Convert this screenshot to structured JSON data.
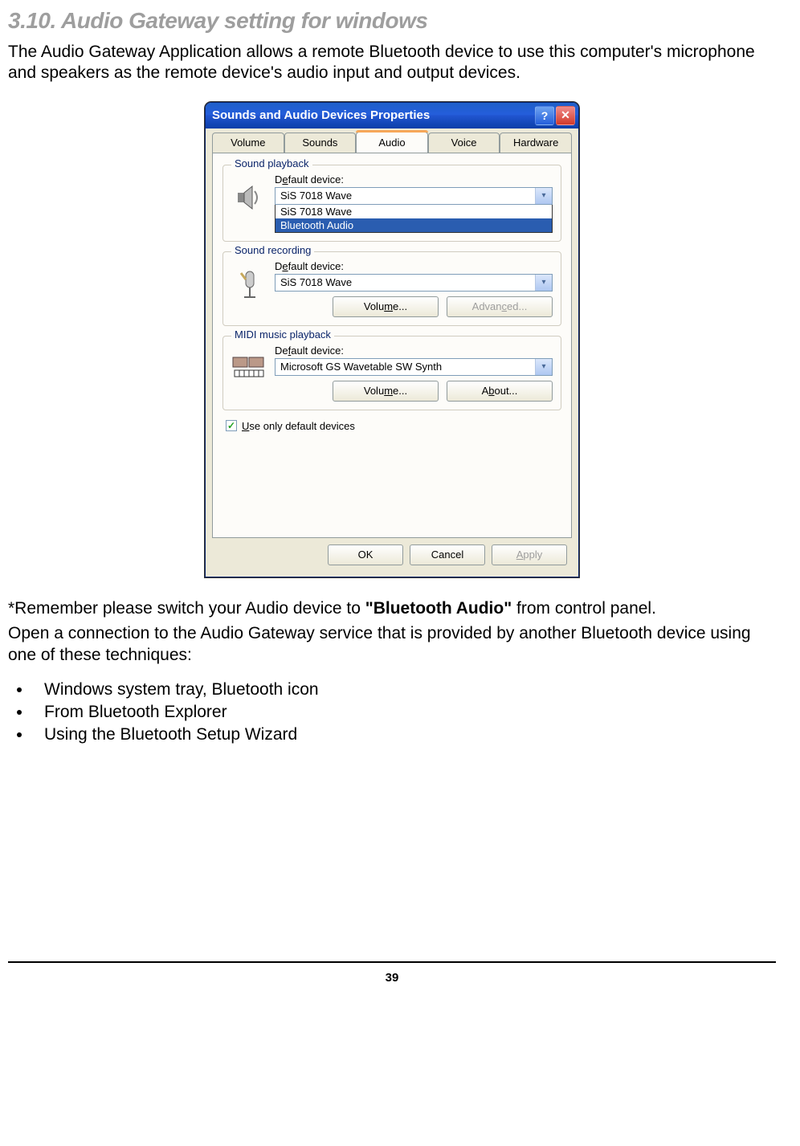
{
  "heading": "3.10. Audio Gateway setting for windows",
  "intro": "The Audio Gateway Application allows a remote Bluetooth device to use this computer's microphone and speakers as the remote device's audio input and output devices.",
  "dialog": {
    "title": "Sounds and Audio Devices Properties",
    "tabs": [
      "Volume",
      "Sounds",
      "Audio",
      "Voice",
      "Hardware"
    ],
    "active_tab": "Audio",
    "playback": {
      "legend": "Sound playback",
      "label_prefix": "D",
      "label_underline": "e",
      "label_suffix": "fault device:",
      "value": "SiS 7018 Wave",
      "options": [
        "SiS 7018 Wave",
        "Bluetooth Audio"
      ]
    },
    "recording": {
      "legend": "Sound recording",
      "label_prefix": "D",
      "label_underline": "e",
      "label_suffix": "fault device:",
      "value": "SiS 7018 Wave",
      "volume_btn_pre": "Volu",
      "volume_btn_u": "m",
      "volume_btn_post": "e...",
      "advanced_btn_pre": "Advan",
      "advanced_btn_u": "c",
      "advanced_btn_post": "ed..."
    },
    "midi": {
      "legend": "MIDI music playback",
      "label_prefix": "De",
      "label_underline": "f",
      "label_suffix": "ault device:",
      "value": "Microsoft GS Wavetable SW Synth",
      "volume_btn_pre": "Volu",
      "volume_btn_u": "m",
      "volume_btn_post": "e...",
      "about_btn_pre": "A",
      "about_btn_u": "b",
      "about_btn_post": "out..."
    },
    "checkbox_pre": "",
    "checkbox_u": "U",
    "checkbox_post": "se only default devices",
    "checkbox_checked": true,
    "footer": {
      "ok": "OK",
      "cancel": "Cancel",
      "apply_u": "A",
      "apply_post": "pply"
    }
  },
  "note_prefix": "*Remember please switch your Audio device to ",
  "note_bold": "\"Bluetooth Audio\"",
  "note_suffix": " from control panel.",
  "para2": "Open a connection to the Audio Gateway service that is provided by another Bluetooth device using one of these techniques:",
  "techniques": [
    "Windows system tray, Bluetooth icon",
    "From Bluetooth Explorer",
    "Using the Bluetooth Setup Wizard"
  ],
  "page_number": "39"
}
